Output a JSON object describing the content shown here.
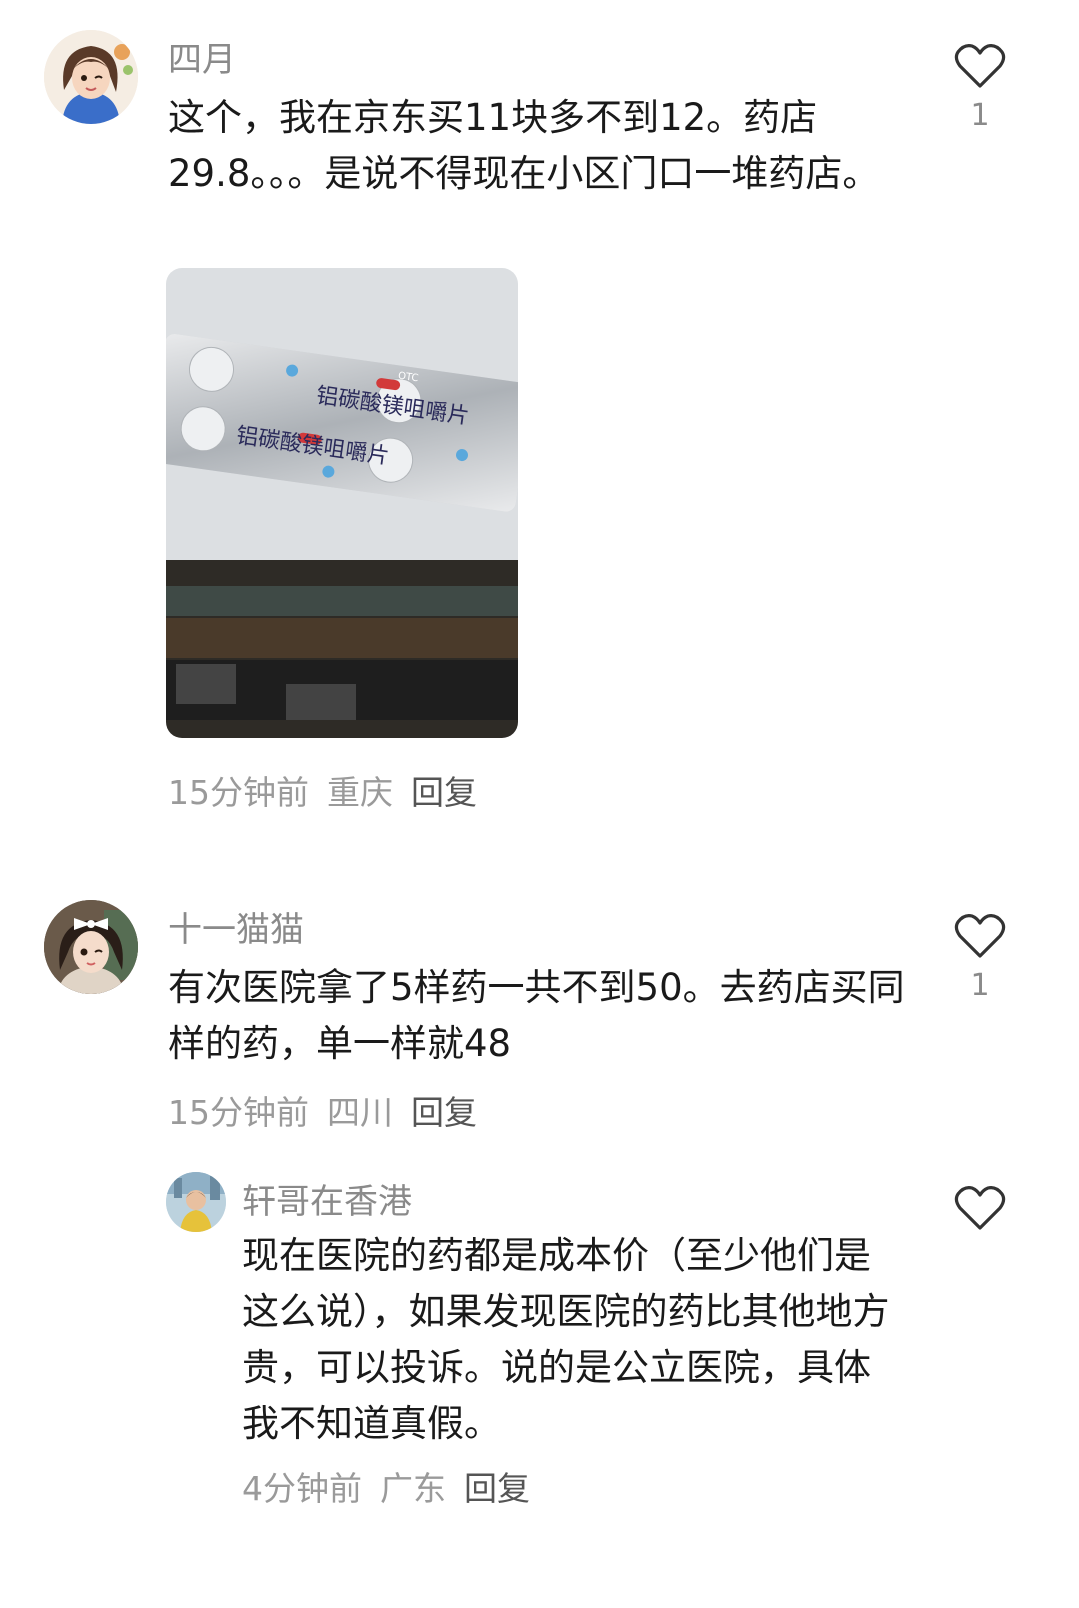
{
  "comments": [
    {
      "user": "四月",
      "text": "这个，我在京东买11块多不到12。药店29.8。。。是说不得现在小区门口一堆药店。",
      "time": "15分钟前",
      "location": "重庆",
      "reply": "回复",
      "likes": "1",
      "avatar_icon": "cartoon-girl-avatar",
      "photo": {
        "pack_text": "铝碳酸镁咀嚼片",
        "otc_label": "OTC"
      }
    },
    {
      "user": "十一猫猫",
      "text": "有次医院拿了5样药一共不到50。去药店买同样的药，单一样就48",
      "time": "15分钟前",
      "location": "四川",
      "reply": "回复",
      "likes": "1",
      "avatar_icon": "girl-with-bow-avatar"
    },
    {
      "user": "轩哥在香港",
      "text": "现在医院的药都是成本价（至少他们是这么说），如果发现医院的药比其他地方贵，可以投诉。说的是公立医院，具体我不知道真假。",
      "time": "4分钟前",
      "location": "广东",
      "reply": "回复",
      "likes": "",
      "avatar_icon": "boy-photo-avatar"
    }
  ],
  "colors": {
    "text": "#1a1a1a",
    "meta": "#9a9a9a",
    "username": "#8a8a8a"
  }
}
